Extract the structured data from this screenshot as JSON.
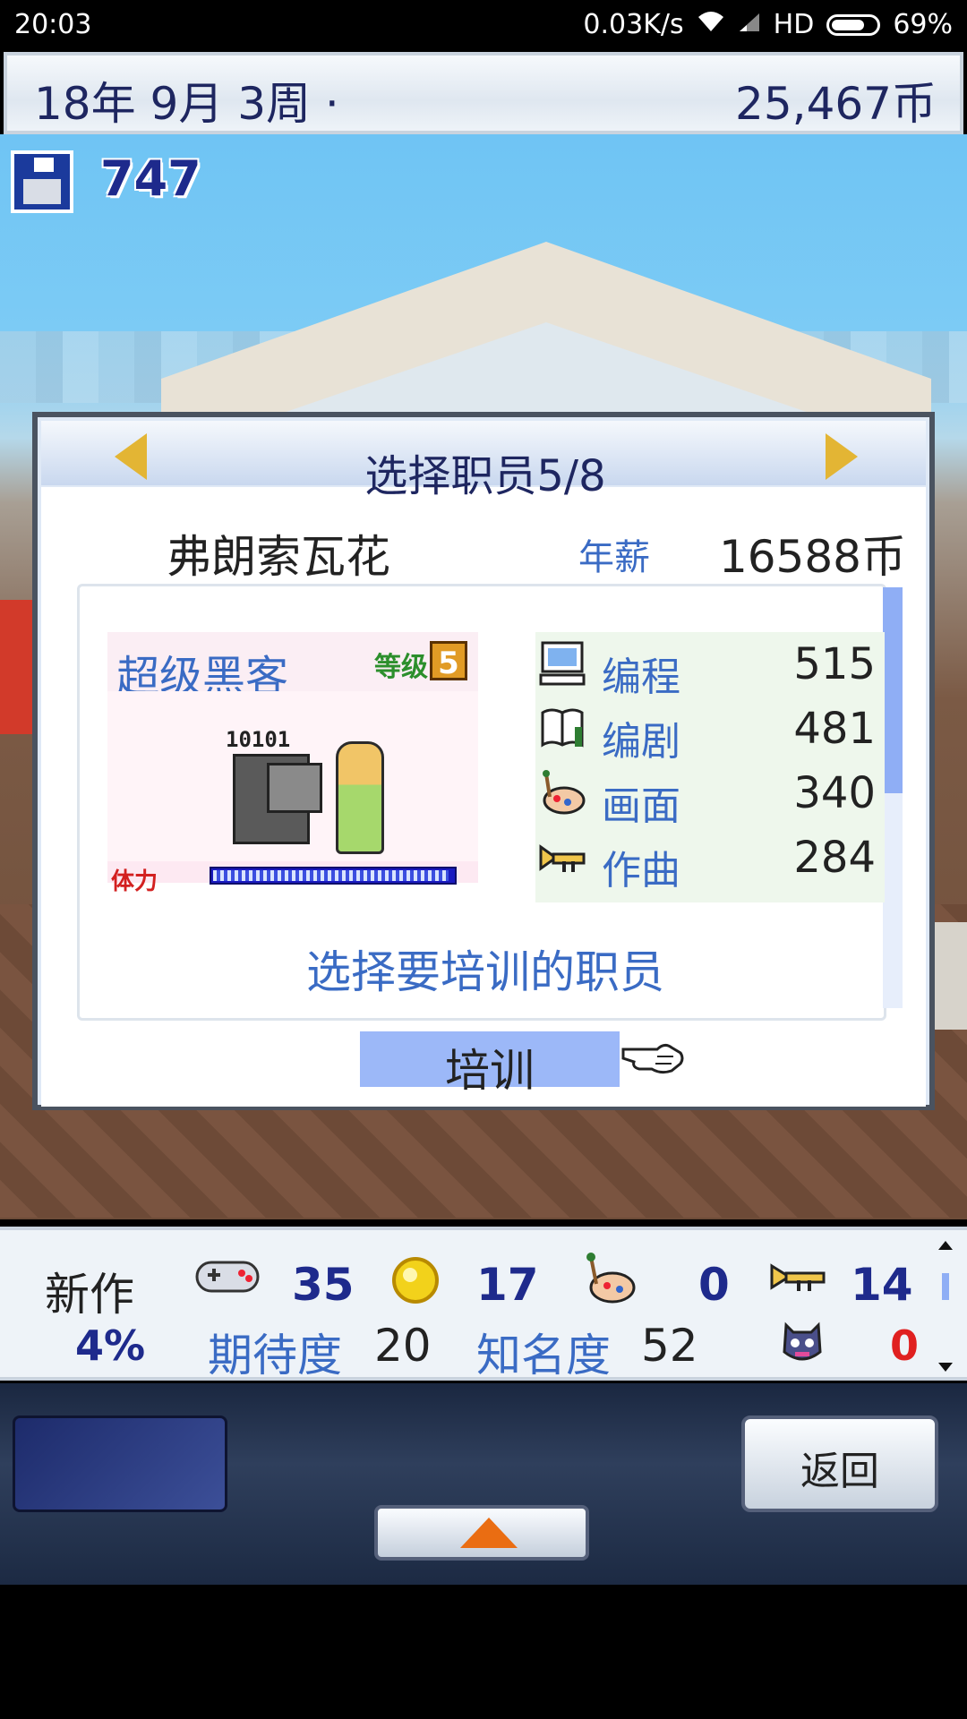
{
  "status_bar": {
    "time": "20:03",
    "speed": "0.03K/s",
    "network": "HD",
    "battery": "69%"
  },
  "header": {
    "date": "18年 9月 3周 ·",
    "money": "25,467币"
  },
  "save": {
    "count": "747"
  },
  "dialog": {
    "title": "选择职员5/8",
    "employee_name": "弗朗索瓦花",
    "salary_label": "年薪",
    "salary_value": "16588币",
    "job": {
      "name": "超级黑客",
      "level_label": "等级",
      "level": "5",
      "code": "10101"
    },
    "stamina": {
      "label": "体力",
      "level": 0.98
    },
    "stats": [
      {
        "icon": "computer-icon",
        "name": "编程",
        "value": "515"
      },
      {
        "icon": "book-icon",
        "name": "编剧",
        "value": "481"
      },
      {
        "icon": "palette-icon",
        "name": "画面",
        "value": "340"
      },
      {
        "icon": "trumpet-icon",
        "name": "作曲",
        "value": "284"
      }
    ],
    "instruction": "选择要培训的职员",
    "train_label": "培训"
  },
  "info_panel": {
    "new_label": "新作",
    "progress": "4%",
    "fun": "35",
    "creativity": "17",
    "graphics": "0",
    "sound": "14",
    "expectation_label": "期待度",
    "expectation_value": "20",
    "fame_label": "知名度",
    "fame_value": "52",
    "bugs": "0"
  },
  "nav": {
    "back_label": "返回"
  },
  "colors": {
    "accent_blue": "#3a6bc4",
    "title_navy": "#1e2660",
    "selected_button": "#9cb8f8",
    "orange_arrow": "#ea6d12"
  }
}
